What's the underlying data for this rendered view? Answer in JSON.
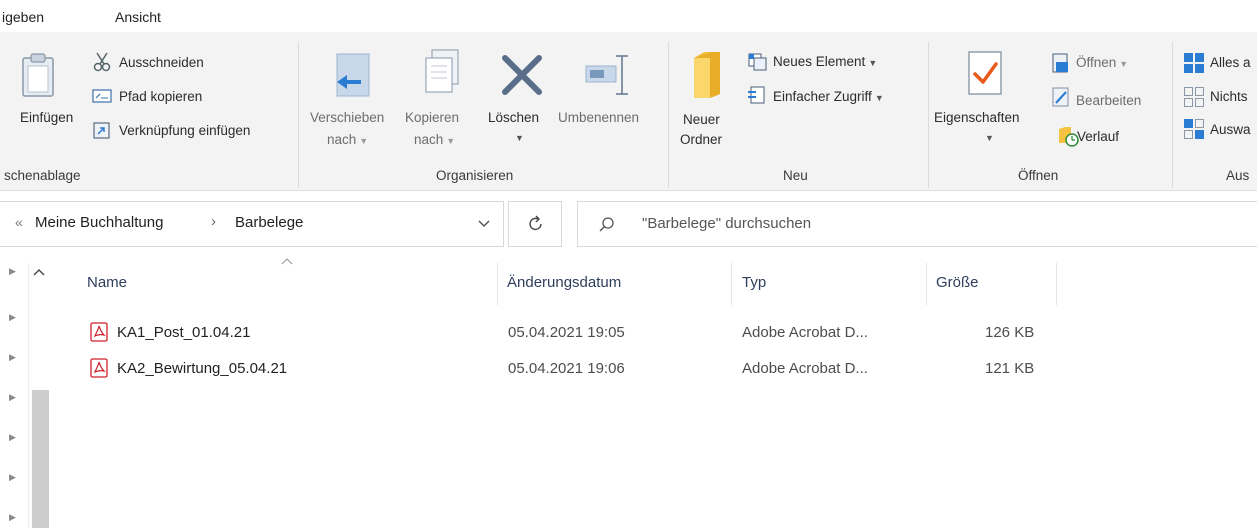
{
  "menu": {
    "tab_share": "igeben",
    "tab_view": "Ansicht"
  },
  "ribbon": {
    "clipboard": {
      "paste_label": "Einfügen",
      "cut_label": "Ausschneiden",
      "copy_path_label": "Pfad kopieren",
      "paste_shortcut_label": "Verknüpfung einfügen",
      "group_label": "schenablage"
    },
    "organize": {
      "move_label_1": "Verschieben",
      "move_label_2": "nach",
      "copy_label_1": "Kopieren",
      "copy_label_2": "nach",
      "delete_label": "Löschen",
      "rename_label": "Umbenennen",
      "group_label": "Organisieren"
    },
    "new": {
      "new_folder_label_1": "Neuer",
      "new_folder_label_2": "Ordner",
      "new_item_label": "Neues Element",
      "easy_access_label": "Einfacher Zugriff",
      "group_label": "Neu"
    },
    "open": {
      "properties_label": "Eigenschaften",
      "open_label": "Öffnen",
      "edit_label": "Bearbeiten",
      "history_label": "Verlauf",
      "group_label": "Öffnen"
    },
    "select": {
      "select_all_label": "Alles a",
      "select_none_label": "Nichts",
      "invert_label": "Auswa",
      "group_label": "Aus"
    }
  },
  "address": {
    "overflow": "«",
    "crumbs": [
      "Meine Buchhaltung",
      "Barbelege"
    ],
    "separator": "›",
    "search_placeholder": "\"Barbelege\" durchsuchen"
  },
  "columns": {
    "name": "Name",
    "date": "Änderungsdatum",
    "type": "Typ",
    "size": "Größe"
  },
  "files": [
    {
      "name": "KA1_Post_01.04.21",
      "date": "05.04.2021 19:05",
      "type": "Adobe Acrobat D...",
      "size": "126 KB"
    },
    {
      "name": "KA2_Bewirtung_05.04.21",
      "date": "05.04.2021 19:06",
      "type": "Adobe Acrobat D...",
      "size": "121 KB"
    }
  ],
  "colors": {
    "accent_blue": "#2b7cd3",
    "pdf_red": "#d11f2a",
    "folder_yellow": "#f5c242",
    "check_orange": "#e8591a"
  }
}
